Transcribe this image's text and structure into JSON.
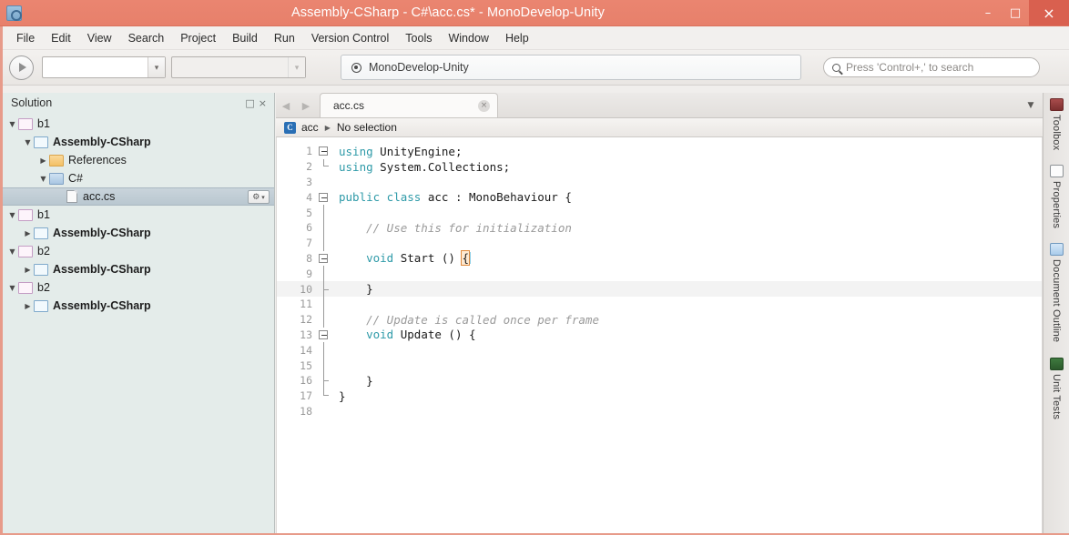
{
  "window": {
    "title": "Assembly-CSharp - C#\\acc.cs* - MonoDevelop-Unity",
    "app_icon": "monodevelop-icon",
    "minimize": "–",
    "maximize": "□",
    "close": "×",
    "titlebar_color": "#e8806b",
    "close_button_color": "#d9604f"
  },
  "menubar": {
    "items": [
      {
        "label": "File"
      },
      {
        "label": "Edit"
      },
      {
        "label": "View"
      },
      {
        "label": "Search"
      },
      {
        "label": "Project"
      },
      {
        "label": "Build"
      },
      {
        "label": "Run"
      },
      {
        "label": "Version Control"
      },
      {
        "label": "Tools"
      },
      {
        "label": "Window"
      },
      {
        "label": "Help"
      }
    ]
  },
  "toolbar": {
    "run_button": "run-play-icon",
    "configuration_combo": {
      "value": "",
      "arrow": "▾"
    },
    "runtime_combo": {
      "value": "",
      "arrow": "▾"
    },
    "status_widget": {
      "text": "MonoDevelop-Unity",
      "icon": "record-dot-icon"
    },
    "search": {
      "placeholder": "Press 'Control+,' to search",
      "value": "",
      "icon": "search-icon"
    }
  },
  "solution_pad": {
    "title": "Solution",
    "minimize_label": "□",
    "close_label": "×",
    "tree": [
      {
        "label": "b1",
        "indent": 0,
        "twisty": "▼",
        "icon": "solution-icon",
        "bold": false,
        "selected": false
      },
      {
        "label": "Assembly-CSharp",
        "indent": 1,
        "twisty": "▼",
        "icon": "project-icon",
        "bold": true,
        "selected": false
      },
      {
        "label": "References",
        "indent": 2,
        "twisty": "▶",
        "icon": "folder-orange-icon",
        "bold": false,
        "selected": false
      },
      {
        "label": "C#",
        "indent": 2,
        "twisty": "▼",
        "icon": "folder-blue-icon",
        "bold": false,
        "selected": false
      },
      {
        "label": "acc.cs",
        "indent": 3,
        "twisty": "",
        "icon": "csharp-file-icon",
        "bold": false,
        "selected": true,
        "gear": "⚙"
      },
      {
        "label": "b1",
        "indent": 0,
        "twisty": "▼",
        "icon": "solution-icon",
        "bold": false,
        "selected": false
      },
      {
        "label": "Assembly-CSharp",
        "indent": 1,
        "twisty": "▶",
        "icon": "project-icon",
        "bold": true,
        "selected": false
      },
      {
        "label": "b2",
        "indent": 0,
        "twisty": "▼",
        "icon": "solution-icon",
        "bold": false,
        "selected": false
      },
      {
        "label": "Assembly-CSharp",
        "indent": 1,
        "twisty": "▶",
        "icon": "project-icon",
        "bold": true,
        "selected": false
      },
      {
        "label": "b2",
        "indent": 0,
        "twisty": "▼",
        "icon": "solution-icon",
        "bold": false,
        "selected": false
      },
      {
        "label": "Assembly-CSharp",
        "indent": 1,
        "twisty": "▶",
        "icon": "project-icon",
        "bold": true,
        "selected": false
      }
    ]
  },
  "editor": {
    "nav_back": "◀",
    "nav_forward": "▶",
    "tab": {
      "label": "acc.cs",
      "close": "×"
    },
    "tablist_button": "▼",
    "breadcrumb": {
      "class_icon": "C",
      "type": "acc",
      "separator": "▶",
      "member": "No selection"
    },
    "lines": [
      {
        "n": "1",
        "fold": "box",
        "segments": [
          {
            "t": "using",
            "c": "kw"
          },
          {
            "t": " UnityEngine;",
            "c": ""
          }
        ]
      },
      {
        "n": "2",
        "fold": "corner",
        "segments": [
          {
            "t": "using",
            "c": "kw"
          },
          {
            "t": " System.Collections;",
            "c": ""
          }
        ]
      },
      {
        "n": "3",
        "fold": "none",
        "segments": []
      },
      {
        "n": "4",
        "fold": "box",
        "segments": [
          {
            "t": "public class",
            "c": "kw"
          },
          {
            "t": " acc : MonoBehaviour {",
            "c": ""
          }
        ]
      },
      {
        "n": "5",
        "fold": "line",
        "segments": []
      },
      {
        "n": "6",
        "fold": "line",
        "segments": [
          {
            "t": "    // Use this for initialization",
            "c": "cm"
          }
        ]
      },
      {
        "n": "7",
        "fold": "line",
        "segments": []
      },
      {
        "n": "8",
        "fold": "box",
        "segments": [
          {
            "t": "    ",
            "c": ""
          },
          {
            "t": "void",
            "c": "kw"
          },
          {
            "t": " Start () ",
            "c": ""
          },
          {
            "t": "{",
            "c": "brace"
          }
        ]
      },
      {
        "n": "9",
        "fold": "line",
        "segments": []
      },
      {
        "n": "10",
        "fold": "tick",
        "segments": [
          {
            "t": "    }",
            "c": ""
          }
        ],
        "highlight": true
      },
      {
        "n": "11",
        "fold": "line",
        "segments": []
      },
      {
        "n": "12",
        "fold": "line",
        "segments": [
          {
            "t": "    // Update is called once per frame",
            "c": "cm"
          }
        ]
      },
      {
        "n": "13",
        "fold": "box",
        "segments": [
          {
            "t": "    ",
            "c": ""
          },
          {
            "t": "void",
            "c": "kw"
          },
          {
            "t": " Update () {",
            "c": ""
          }
        ]
      },
      {
        "n": "14",
        "fold": "line",
        "segments": []
      },
      {
        "n": "15",
        "fold": "line",
        "segments": []
      },
      {
        "n": "16",
        "fold": "tick",
        "segments": [
          {
            "t": "    }",
            "c": ""
          }
        ]
      },
      {
        "n": "17",
        "fold": "corner",
        "segments": [
          {
            "t": "}",
            "c": ""
          }
        ]
      },
      {
        "n": "18",
        "fold": "none",
        "segments": []
      }
    ]
  },
  "right_dock": {
    "tabs": [
      {
        "label": "Toolbox",
        "icon": "toolbox-icon"
      },
      {
        "label": "Properties",
        "icon": "properties-grid-icon"
      },
      {
        "label": "Document Outline",
        "icon": "document-outline-icon"
      },
      {
        "label": "Unit Tests",
        "icon": "unit-tests-icon"
      }
    ]
  }
}
